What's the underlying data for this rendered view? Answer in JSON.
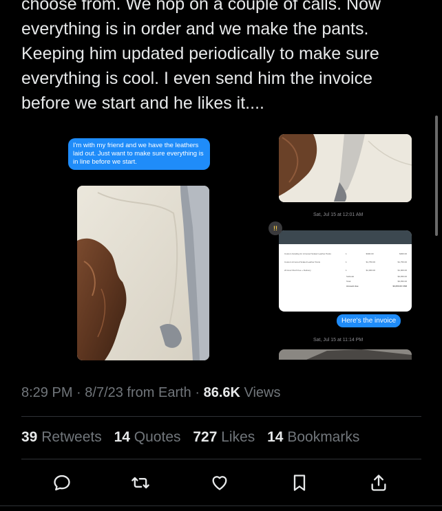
{
  "tweet": {
    "lines": [
      "choose from. We hop on a couple of calls. Now",
      "everything is in order and we make the pants.",
      "Keeping him updated periodically to make sure",
      "everything is cool. I even send him the invoice",
      "before we start and he likes it...."
    ]
  },
  "media": {
    "left_bubble": "I'm with my friend and we have the leathers laid out. Just want to make sure everything is in line before we start.",
    "timestamp_1": "Sat, Jul 15 at 12:01 AM",
    "invoice_bubble": "Here's the invoice",
    "timestamp_2": "Sat, Jul 15 at 11:14 PM",
    "reaction": "!!",
    "invoice_rows": [
      {
        "item": "Custom Grading for Armored Scaled Leather Pants",
        "qty": "1",
        "rate": "$300.00",
        "amount": "$300.00"
      },
      {
        "item": "Custom Armored Scaled Leather Pants",
        "qty": "1",
        "rate": "$1,750.00",
        "amount": "$1,750.00"
      },
      {
        "item": "24 Hour Rush Fee + Delivery",
        "qty": "1",
        "rate": "$1,000.00",
        "amount": "$1,000.00"
      }
    ],
    "invoice_totals": [
      {
        "label": "Subtotal",
        "value": "$3,050.00"
      },
      {
        "label": "Total",
        "value": "$3,050.00"
      },
      {
        "label": "Amount due",
        "value": "$3,050.00 USD"
      }
    ]
  },
  "meta": {
    "time": "8:29 PM",
    "sep1": " · ",
    "date": "8/7/23",
    "source": " from Earth",
    "sep2": " · ",
    "views_count": "86.6K",
    "views_label": " Views"
  },
  "stats": {
    "retweets_count": "39",
    "retweets_label": "Retweets",
    "quotes_count": "14",
    "quotes_label": "Quotes",
    "likes_count": "727",
    "likes_label": "Likes",
    "bookmarks_count": "14",
    "bookmarks_label": "Bookmarks"
  },
  "actions": [
    "reply-icon",
    "retweet-icon",
    "like-icon",
    "bookmark-icon",
    "share-icon"
  ],
  "colors": {
    "background": "#000000",
    "text": "#e7e9ea",
    "muted": "#71767b",
    "imessage_blue": "#1f8cf9",
    "divider": "#2f3336"
  }
}
